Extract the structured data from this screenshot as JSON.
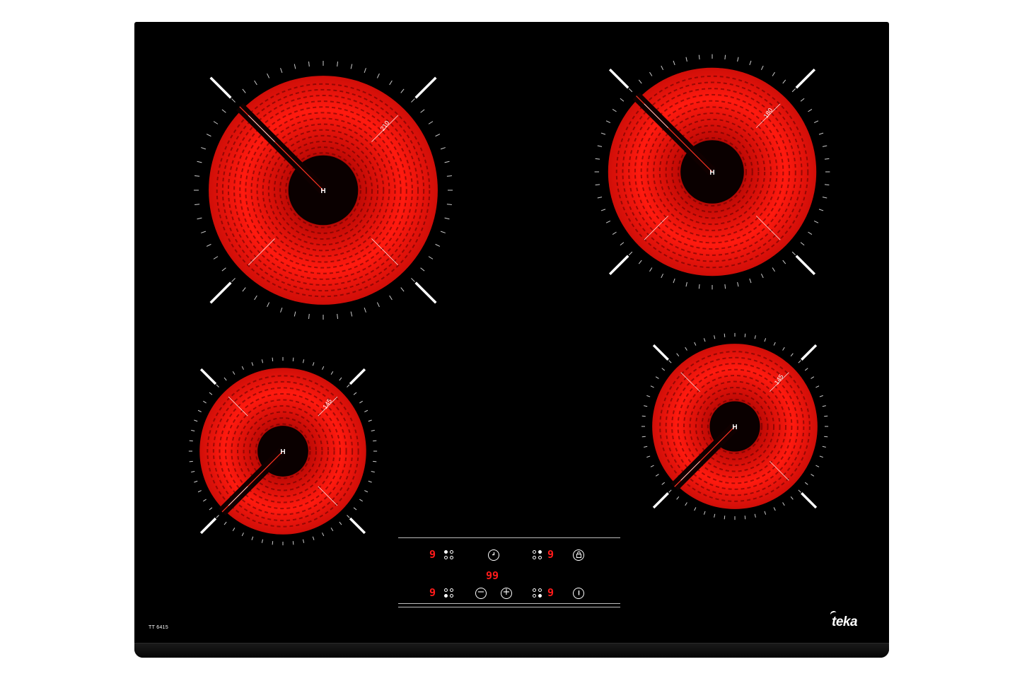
{
  "product": {
    "model": "TT 6415",
    "brand": "teka"
  },
  "colors": {
    "surface": "#000000",
    "glow": "#ff1a0f",
    "display": "#ff1a1a",
    "marking": "#ffffff"
  },
  "zones": [
    {
      "id": "front-left-large",
      "size_label": "210",
      "hot_label": "H"
    },
    {
      "id": "rear-right",
      "size_label": "180",
      "hot_label": "H"
    },
    {
      "id": "front-left-small",
      "size_label": "145",
      "hot_label": "H"
    },
    {
      "id": "front-right-small",
      "size_label": "145",
      "hot_label": "H"
    }
  ],
  "control_panel": {
    "displays": {
      "top_left": "9",
      "top_right": "9",
      "timer": "99",
      "bottom_left": "9",
      "bottom_right": "9"
    },
    "icons": {
      "timer": "clock-icon",
      "lock": "lock-icon",
      "minus": "minus-icon",
      "plus": "plus-icon",
      "power": "power-icon"
    },
    "minus_glyph": "−",
    "plus_glyph": "+"
  }
}
